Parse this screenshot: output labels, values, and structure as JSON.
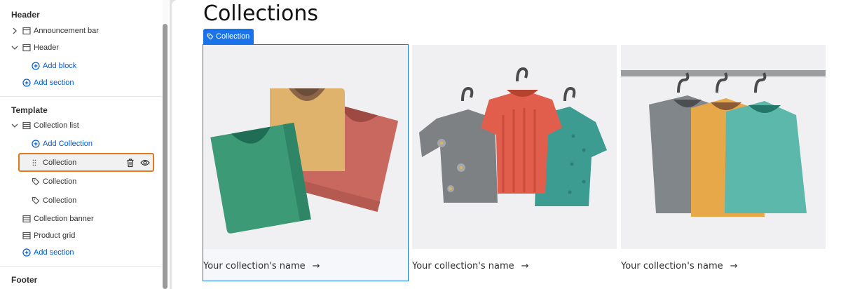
{
  "sidebar": {
    "header_section": {
      "title": "Header",
      "items": [
        {
          "label": "Announcement bar"
        },
        {
          "label": "Header"
        }
      ],
      "add_block": "Add block",
      "add_section": "Add section"
    },
    "template_section": {
      "title": "Template",
      "collection_list": "Collection list",
      "add_collection": "Add Collection",
      "collections": [
        {
          "label": "Collection"
        },
        {
          "label": "Collection"
        },
        {
          "label": "Collection"
        }
      ],
      "collection_banner": "Collection banner",
      "product_grid": "Product grid",
      "add_section": "Add section"
    },
    "footer_section": {
      "title": "Footer"
    }
  },
  "preview": {
    "title": "Collections",
    "badge": "Collection",
    "cards": [
      {
        "name": "Your collection's name",
        "arrow": "→"
      },
      {
        "name": "Your collection's name",
        "arrow": "→"
      },
      {
        "name": "Your collection's name",
        "arrow": "→"
      }
    ]
  },
  "colors": {
    "accent": "#1a73e8",
    "link": "#005bd3",
    "selection_outline": "#e07a1f"
  }
}
